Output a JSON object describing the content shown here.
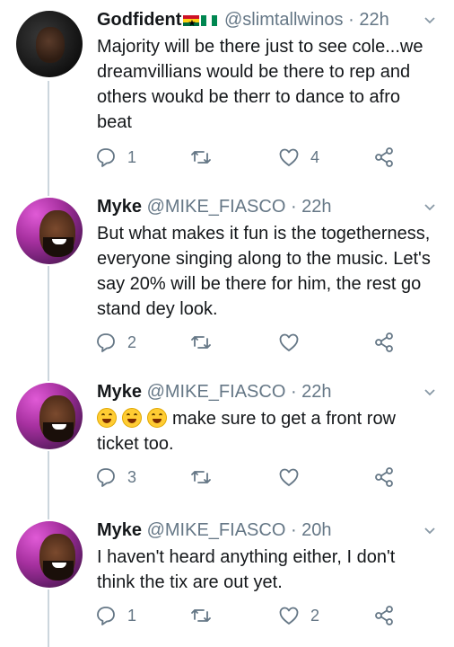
{
  "tweets": [
    {
      "name": "Godfident",
      "handle": "@slimtallwinos",
      "dot": "·",
      "time": "22h",
      "text": "Majority will be there just to see cole...we dreamvillians would be there to rep and others woukd be therr to dance to afro beat",
      "replies": "1",
      "retweets": "",
      "likes": "4"
    },
    {
      "name": "Myke",
      "handle": "@MIKE_FIASCO",
      "dot": "·",
      "time": "22h",
      "text": "But what makes it fun is the togetherness, everyone singing along to the music. Let's say 20% will be there for him, the rest go stand dey look.",
      "replies": "2",
      "retweets": "",
      "likes": ""
    },
    {
      "name": "Myke",
      "handle": "@MIKE_FIASCO",
      "dot": "·",
      "time": "22h",
      "text": "make sure to get a front row ticket too.",
      "replies": "3",
      "retweets": "",
      "likes": ""
    },
    {
      "name": "Myke",
      "handle": "@MIKE_FIASCO",
      "dot": "·",
      "time": "20h",
      "text": "I haven't heard anything either, I don't think the tix are out yet.",
      "replies": "1",
      "retweets": "",
      "likes": "2"
    }
  ],
  "icons": {
    "reply": "reply-icon",
    "retweet": "retweet-icon",
    "like": "heart-icon",
    "share": "share-icon",
    "caret": "chevron-down-icon"
  },
  "colors": {
    "text": "#14171a",
    "muted": "#657786",
    "thread_line": "#ccd6dd"
  }
}
